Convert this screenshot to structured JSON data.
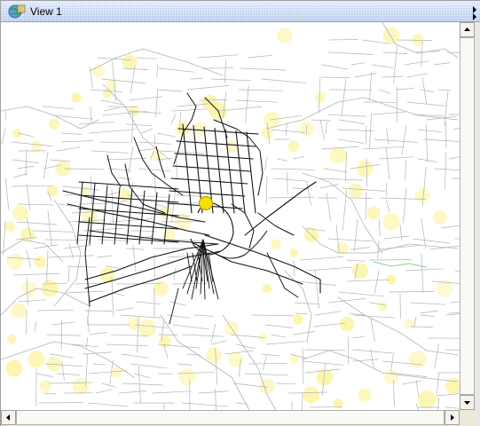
{
  "window": {
    "title": "View 1",
    "icon": "globe-map-icon"
  },
  "map": {
    "colors": {
      "main_roads": "#111111",
      "minor_roads": "#b4b4b4",
      "hotspots": "#fbf39a",
      "marker_fill": "#f4e000",
      "marker_stroke": "#b8a000",
      "greenline": "#8ccf8c"
    }
  },
  "scrollbars": {
    "up_icon": "arrow-up-icon",
    "down_icon": "arrow-down-icon",
    "left_icon": "arrow-left-icon",
    "right_icon": "arrow-right-icon"
  }
}
